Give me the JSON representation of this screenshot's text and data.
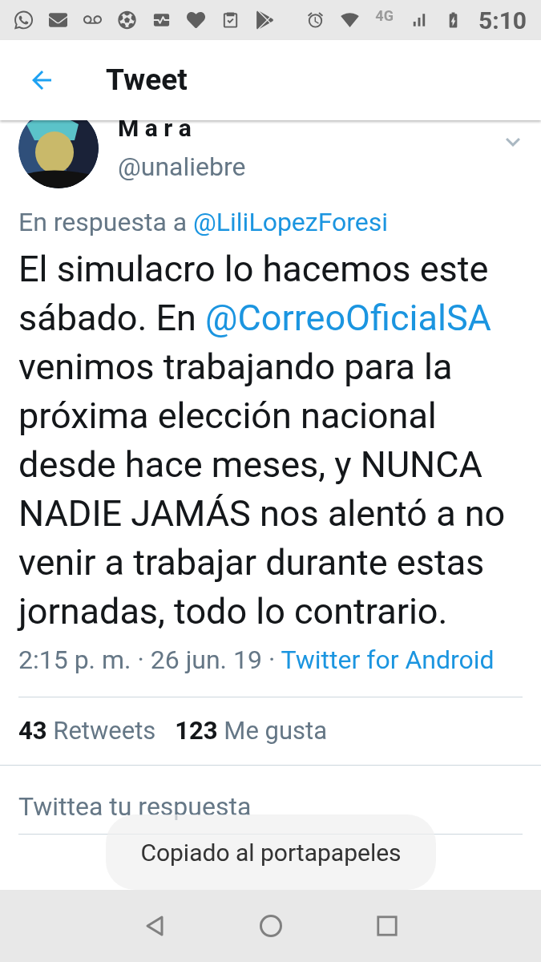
{
  "status_bar": {
    "network": "4G",
    "time": "5:10"
  },
  "header": {
    "title": "Tweet"
  },
  "tweet": {
    "name": "M a r a",
    "handle": "@unaliebre",
    "reply_prefix": "En respuesta a",
    "reply_to": "@LiliLopezForesi",
    "body": [
      {
        "kind": "text",
        "text": "El simulacro lo hacemos este sábado. En "
      },
      {
        "kind": "mention",
        "text": "@CorreoOficialSA"
      },
      {
        "kind": "text",
        "text": " venimos trabajando para la próxima elección nacional desde hace meses, y NUNCA NADIE JAMÁS nos alentó a no venir a trabajar durante estas jornadas, todo lo contrario."
      }
    ],
    "time": "2:15 p. m. · 26 jun. 19 · ",
    "source": "Twitter for Android",
    "stats": [
      {
        "count": "43",
        "label": "Retweets"
      },
      {
        "count": "123",
        "label": "Me gusta"
      }
    ]
  },
  "reply": {
    "placeholder": "Twittea tu respuesta"
  },
  "toast": "Copiado al portapapeles"
}
